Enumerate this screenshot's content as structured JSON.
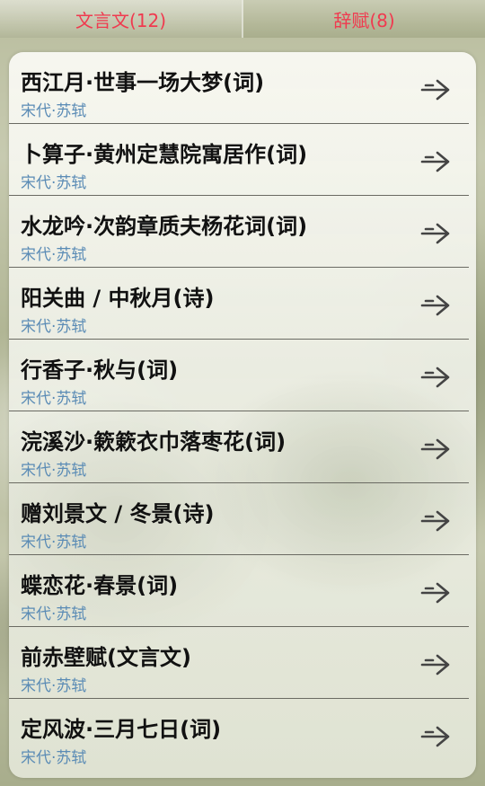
{
  "tabs": [
    {
      "label": "文言文(12)",
      "active": true
    },
    {
      "label": "辞赋(8)",
      "active": false
    }
  ],
  "items": [
    {
      "title": "西江月·世事一场大梦(词)",
      "subtitle": "宋代·苏轼",
      "icon": "arrow-right-icon"
    },
    {
      "title": "卜算子·黄州定慧院寓居作(词)",
      "subtitle": "宋代·苏轼",
      "icon": "arrow-right-icon"
    },
    {
      "title": "水龙吟·次韵章质夫杨花词(词)",
      "subtitle": "宋代·苏轼",
      "icon": "arrow-right-icon"
    },
    {
      "title": "阳关曲 / 中秋月(诗)",
      "subtitle": "宋代·苏轼",
      "icon": "arrow-right-icon"
    },
    {
      "title": "行香子·秋与(词)",
      "subtitle": "宋代·苏轼",
      "icon": "arrow-right-icon"
    },
    {
      "title": "浣溪沙·簌簌衣巾落枣花(词)",
      "subtitle": "宋代·苏轼",
      "icon": "arrow-right-icon"
    },
    {
      "title": "赠刘景文 / 冬景(诗)",
      "subtitle": "宋代·苏轼",
      "icon": "arrow-right-icon"
    },
    {
      "title": "蝶恋花·春景(词)",
      "subtitle": "宋代·苏轼",
      "icon": "arrow-right-icon"
    },
    {
      "title": "前赤壁赋(文言文)",
      "subtitle": "宋代·苏轼",
      "icon": "arrow-right-icon"
    },
    {
      "title": "定风波·三月七日(词)",
      "subtitle": "宋代·苏轼",
      "icon": "arrow-right-icon"
    }
  ],
  "colors": {
    "tab_text": "#f03a4f",
    "subtitle": "#5a8bb5",
    "title": "#111111"
  }
}
